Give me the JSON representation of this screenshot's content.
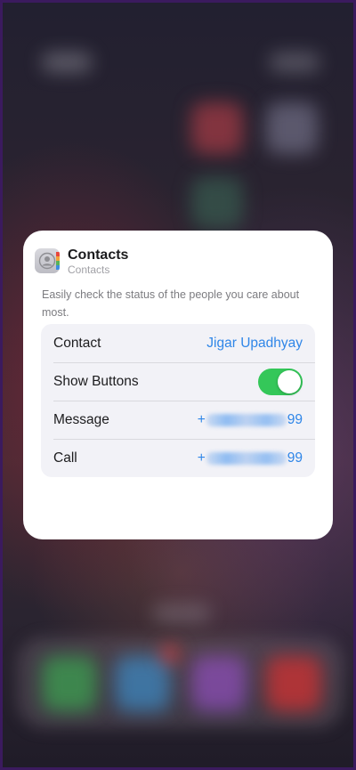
{
  "widget": {
    "title": "Contacts",
    "subtitle": "Contacts",
    "description": "Easily check the status of the people you care about most."
  },
  "settings": {
    "contact": {
      "label": "Contact",
      "value": "Jigar Upadhyay"
    },
    "show_buttons": {
      "label": "Show Buttons",
      "enabled": true
    },
    "message": {
      "label": "Message",
      "value_prefix": "+",
      "value_suffix": "99"
    },
    "call": {
      "label": "Call",
      "value_prefix": "+",
      "value_suffix": "99"
    }
  },
  "colors": {
    "accent": "#2f86e8",
    "toggle_on": "#34c759",
    "card": "#ffffff",
    "group_bg": "#f2f2f7"
  },
  "icons": {
    "app_icon": "contacts-app-icon"
  }
}
